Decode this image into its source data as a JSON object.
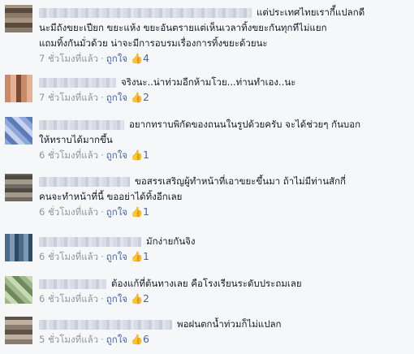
{
  "comments": [
    {
      "text_line1": "แต่ประเทศไทยเรากี็แปลกดี",
      "text_line2": "นะมีถังขยะเปียก ขยะแห้ง ขยะอันตรายแต่เห็นเวลาทิ้งขยะกันทุกทีไม่แยก",
      "text_line3": "แถมทิ้งกันมั่วด้วย น่าจะมีการอบรมเรื่องการทิ้งขยะด้วยนะ",
      "time": "7 ชั่วโมงที่แล้ว",
      "like_label": "ถูกใจ",
      "likes": "4"
    },
    {
      "text_line1": "จริงนะ..น่าท่วมอีกห้ามโวย...ท่านทำเอง..นะ",
      "time": "7 ชั่วโมงที่แล้ว",
      "like_label": "ถูกใจ",
      "likes": "2"
    },
    {
      "text_line1": "อยากทราบพิกัดของถนนในรูปด้วยครับ จะได้ช่วยๆ กันบอก",
      "text_line2": "ให้ทราบได้มากขึ้น",
      "time": "6 ชั่วโมงที่แล้ว",
      "like_label": "ถูกใจ",
      "likes": "1"
    },
    {
      "text_line1": "ขอสรรเสริญผู้ทำหน้าที่เอาขยะขึ้นมา ถ้าไม่มีท่านสักกี่",
      "text_line2": "คนจะทำหน้าที่นี้ ขออย่าได้ทิ้งอีกเลย",
      "time": "6 ชั่วโมงที่แล้ว",
      "like_label": "ถูกใจ",
      "likes": "1"
    },
    {
      "text_line1": "มักง่ายกันจิง",
      "time": "6 ชั่วโมงที่แล้ว",
      "like_label": "ถูกใจ",
      "likes": "1"
    },
    {
      "text_line1": "ต้องแก้ที่ต้นทางเลย คือโรงเรียนระดับประถมเลย",
      "time": "6 ชั่วโมงที่แล้ว",
      "like_label": "ถูกใจ",
      "likes": "2"
    },
    {
      "text_line1": "พอฝนตกน้ำท่วมก็ไม่แปลก",
      "time": "5 ชั่วโมงที่แล้ว",
      "like_label": "ถูกใจ",
      "likes": "6"
    }
  ],
  "icons": {
    "like": "thumbs-up-icon"
  },
  "colors": {
    "link": "#4267b2",
    "meta": "#90949c",
    "text": "#141823",
    "background": "#f6f7f9"
  }
}
